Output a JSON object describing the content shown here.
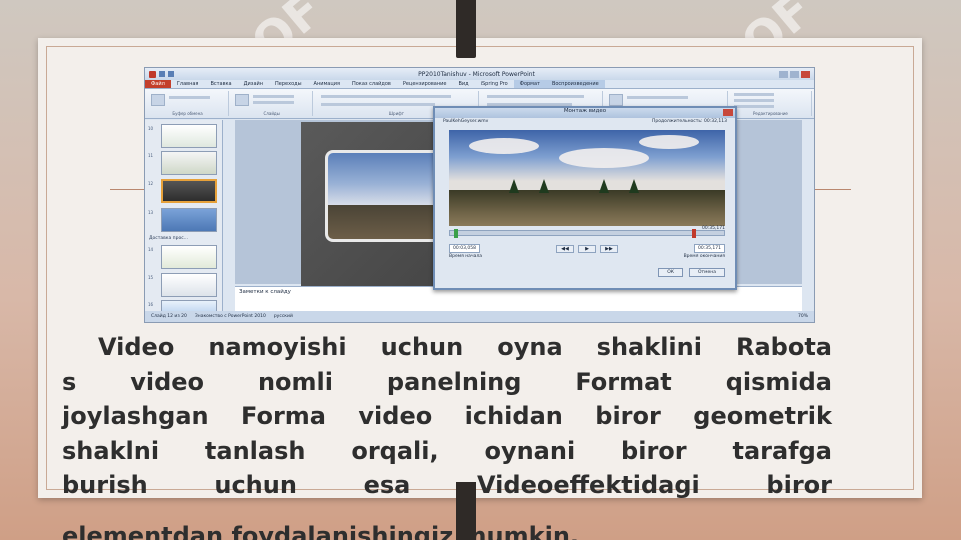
{
  "ppt": {
    "window_title": "PP2010Tanishuv - Microsoft PowerPoint",
    "tabs": [
      "Файл",
      "Главная",
      "Вставка",
      "Дизайн",
      "Переходы",
      "Анимация",
      "Показ слайдов",
      "Рецензирование",
      "Вид",
      "iSpring Pro",
      "Формат",
      "Воспроизведение"
    ],
    "context_tab": "Работа с видео",
    "ribbon_groups": [
      "Буфер обмена",
      "Слайды",
      "Шрифт",
      "Абзац",
      "Рисование",
      "Редактирование"
    ],
    "ribbon_buttons": {
      "paste": "Вставить",
      "new_slide": "Создать слайд",
      "layout": "Макет",
      "reset": "Восстановить",
      "section": "Раздел",
      "shapes": "Фигуры",
      "arrange": "Упорядочить",
      "quick_styles": "Экспресс-стили",
      "find": "Найти",
      "replace": "Заменить",
      "select": "Выделить"
    },
    "thumb_numbers": [
      "10",
      "11",
      "12",
      "13",
      "14",
      "15",
      "16"
    ],
    "section_label": "Доставка прос...",
    "notes_placeholder": "Заметки к слайду",
    "status": {
      "slide": "Слайд 12 из 20",
      "theme": "Знакомство с PowerPoint 2010",
      "lang": "русский",
      "zoom": "70%"
    },
    "dialog": {
      "title": "Монтаж видео",
      "filename": "PaulKehGeyser.wmv",
      "duration_label": "Продолжительность: 00:32,113",
      "end_time_top": "00:35,171",
      "start_time": "00:03,058",
      "start_label": "Время начала",
      "end_time": "00:35,171",
      "end_label": "Время окончания",
      "ok": "ОК",
      "cancel": "Отмена"
    }
  },
  "paragraph": {
    "line1": "Video namoyishi uchun oyna shaklini Rabota",
    "line2": "s video nomli panelning Format qismida",
    "line3": "joylashgan Forma video ichidan biror geometrik",
    "line4": "shaklni tanlash orqali, oynani biror tarafga",
    "line5": "burish uchun esa Videoeffektidagi     biror",
    "line6": "elementdan foydalanishingiz mumkin."
  },
  "watermark_text": "SOF"
}
